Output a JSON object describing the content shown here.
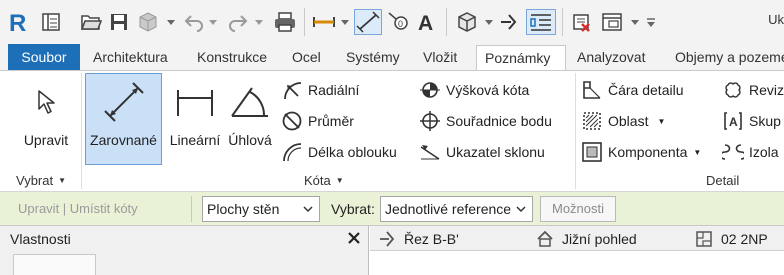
{
  "qat": {
    "icons": [
      "revit-logo-icon",
      "open-icon",
      "save-icon",
      "sync-icon",
      "undo-icon",
      "redo-icon",
      "print-icon",
      "measure-icon",
      "aligned-dimension-icon",
      "tag-icon",
      "text-icon",
      "3d-view-icon",
      "section-icon",
      "thin-lines-icon",
      "close-hidden-icon",
      "switch-windows-icon",
      "customize-icon"
    ],
    "right_text": "Uk"
  },
  "tabs": {
    "file": "Soubor",
    "items": [
      "Architektura",
      "Konstrukce",
      "Ocel",
      "Systémy",
      "Vložit",
      "Poznámky",
      "Analyzovat",
      "Objemy a pozemek"
    ],
    "active": "Poznámky"
  },
  "ribbon": {
    "select_panel": {
      "upravit": "Upravit",
      "title": "Vybrat"
    },
    "dimension_panel": {
      "title": "Kóta",
      "big": [
        "Zarovnané",
        "Lineární",
        "Úhlová"
      ],
      "col1": [
        "Radiální",
        "Průměr",
        "Délka oblouku"
      ],
      "col2": [
        "Výšková kóta",
        "Souřadnice bodu",
        "Ukazatel sklonu"
      ]
    },
    "detail_panel": {
      "title": "Detail",
      "items": [
        "Čára detailu",
        "Oblast",
        "Komponenta"
      ],
      "col2": [
        "Revize",
        "Skup",
        "Izola"
      ]
    }
  },
  "options_bar": {
    "modify_text": "Upravit | Umístit kóty",
    "ref_select": "Plochy stěn",
    "pick_label": "Vybrat:",
    "pick_select": "Jednotlivé reference",
    "options_button": "Možnosti"
  },
  "properties": {
    "title": "Vlastnosti"
  },
  "view_tabs": [
    "Řez B-B'",
    "Jižní pohled",
    "02 2NP"
  ]
}
